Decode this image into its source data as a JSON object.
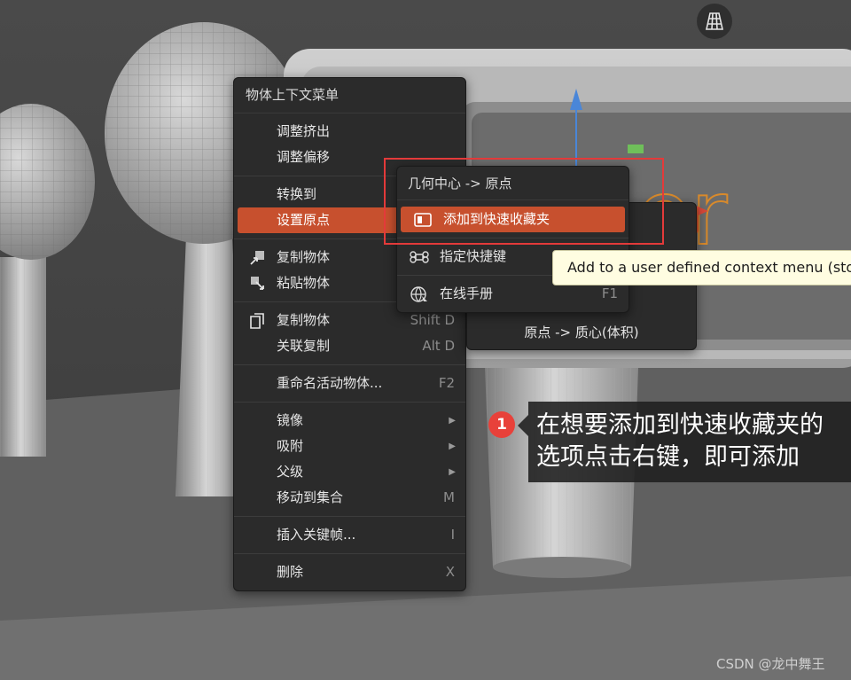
{
  "context_menu": {
    "title": "物体上下文菜单",
    "items": {
      "adjust_extrude": "调整挤出",
      "adjust_offset": "调整偏移",
      "convert_to": "转换到",
      "set_origin": "设置原点",
      "copy_object": "复制物体",
      "paste_object": "粘贴物体",
      "duplicate": "复制物体",
      "duplicate_sc": "Shift D",
      "linked_dup": "关联复制",
      "linked_dup_sc": "Alt D",
      "rename": "重命名活动物体...",
      "rename_sc": "F2",
      "mirror": "镜像",
      "snap": "吸附",
      "parent": "父级",
      "move_to_collection": "移动到集合",
      "move_to_collection_sc": "M",
      "insert_keyframe": "插入关键帧...",
      "insert_keyframe_sc": "I",
      "delete": "删除",
      "delete_sc": "X"
    }
  },
  "origin_submenu": {
    "first": "几何中心 -> 原点",
    "last": "原点 -> 质心(体积)"
  },
  "rightclick_menu": {
    "add_to_quick_fav": "添加到快速收藏夹",
    "assign_shortcut": "指定快捷键",
    "online_manual": "在线手册",
    "online_manual_sc": "F1"
  },
  "tooltip": "Add to a user defined context menu (sto",
  "callout": {
    "badge": "1",
    "line1": "在想要添加到快速收藏夹的",
    "line2": "选项点击右键，即可添加"
  },
  "scene_text": "ler",
  "watermark": "CSDN @龙中舞王",
  "colors": {
    "highlight": "#c7502e",
    "menu_bg": "#2b2b2b",
    "tooltip_bg": "#fffde1",
    "annotation_red": "#e33a3a"
  }
}
